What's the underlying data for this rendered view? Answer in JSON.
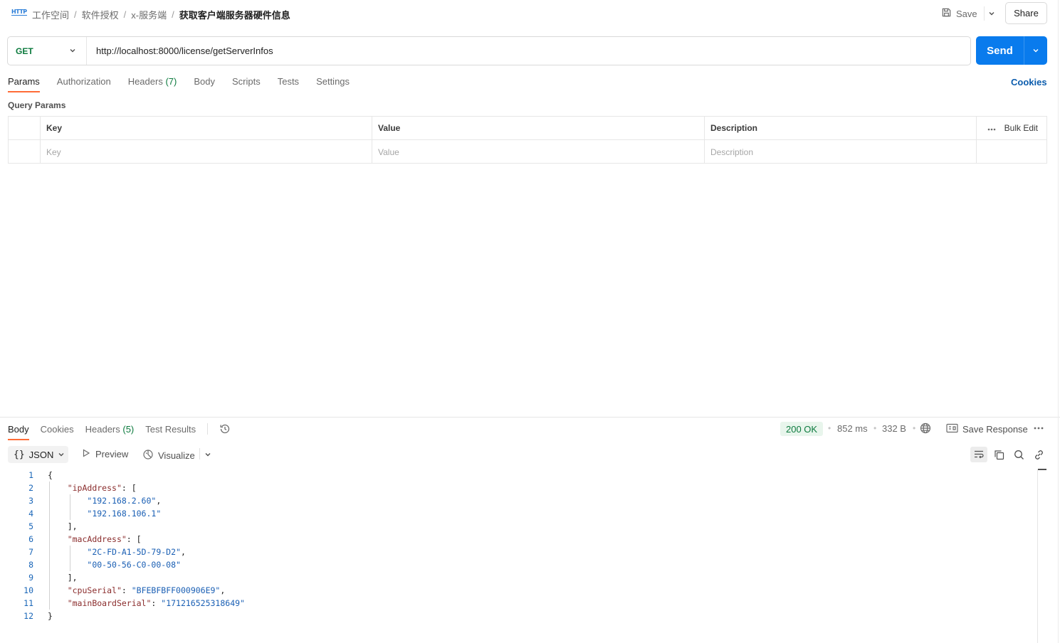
{
  "header": {
    "protocol_icon": "HTTP",
    "breadcrumbs": [
      "工作空间",
      "软件授权",
      "x-服务端"
    ],
    "separator": "/",
    "current": "获取客户端服务器硬件信息",
    "save_label": "Save",
    "share_label": "Share"
  },
  "request": {
    "method": "GET",
    "url": "http://localhost:8000/license/getServerInfos",
    "send_label": "Send",
    "cookies_label": "Cookies",
    "tabs": [
      {
        "label": "Params",
        "active": true
      },
      {
        "label": "Authorization"
      },
      {
        "label": "Headers",
        "count": "(7)"
      },
      {
        "label": "Body"
      },
      {
        "label": "Scripts"
      },
      {
        "label": "Tests"
      },
      {
        "label": "Settings"
      }
    ],
    "query_params_title": "Query Params",
    "table": {
      "headers": {
        "key": "Key",
        "value": "Value",
        "description": "Description",
        "bulk_edit": "Bulk Edit"
      },
      "placeholders": {
        "key": "Key",
        "value": "Value",
        "description": "Description"
      }
    }
  },
  "response": {
    "tabs": [
      {
        "label": "Body",
        "active": true
      },
      {
        "label": "Cookies"
      },
      {
        "label": "Headers",
        "count": "(5)"
      },
      {
        "label": "Test Results"
      }
    ],
    "status": "200 OK",
    "time": "852 ms",
    "size": "332 B",
    "save_response_label": "Save Response",
    "format": "JSON",
    "preview_label": "Preview",
    "visualize_label": "Visualize",
    "code_lines": [
      {
        "n": "1",
        "parts": [
          {
            "t": "p",
            "v": "{"
          }
        ]
      },
      {
        "n": "2",
        "parts": [
          {
            "t": "p",
            "v": "    "
          },
          {
            "t": "k",
            "v": "\"ipAddress\""
          },
          {
            "t": "p",
            "v": ": ["
          }
        ]
      },
      {
        "n": "3",
        "parts": [
          {
            "t": "p",
            "v": "        "
          },
          {
            "t": "s",
            "v": "\"192.168.2.60\""
          },
          {
            "t": "p",
            "v": ","
          }
        ]
      },
      {
        "n": "4",
        "parts": [
          {
            "t": "p",
            "v": "        "
          },
          {
            "t": "s",
            "v": "\"192.168.106.1\""
          }
        ]
      },
      {
        "n": "5",
        "parts": [
          {
            "t": "p",
            "v": "    ],"
          }
        ]
      },
      {
        "n": "6",
        "parts": [
          {
            "t": "p",
            "v": "    "
          },
          {
            "t": "k",
            "v": "\"macAddress\""
          },
          {
            "t": "p",
            "v": ": ["
          }
        ]
      },
      {
        "n": "7",
        "parts": [
          {
            "t": "p",
            "v": "        "
          },
          {
            "t": "s",
            "v": "\"2C-FD-A1-5D-79-D2\""
          },
          {
            "t": "p",
            "v": ","
          }
        ]
      },
      {
        "n": "8",
        "parts": [
          {
            "t": "p",
            "v": "        "
          },
          {
            "t": "s",
            "v": "\"00-50-56-C0-00-08\""
          }
        ]
      },
      {
        "n": "9",
        "parts": [
          {
            "t": "p",
            "v": "    ],"
          }
        ]
      },
      {
        "n": "10",
        "parts": [
          {
            "t": "p",
            "v": "    "
          },
          {
            "t": "k",
            "v": "\"cpuSerial\""
          },
          {
            "t": "p",
            "v": ": "
          },
          {
            "t": "s",
            "v": "\"BFEBFBFF000906E9\""
          },
          {
            "t": "p",
            "v": ","
          }
        ]
      },
      {
        "n": "11",
        "parts": [
          {
            "t": "p",
            "v": "    "
          },
          {
            "t": "k",
            "v": "\"mainBoardSerial\""
          },
          {
            "t": "p",
            "v": ": "
          },
          {
            "t": "s",
            "v": "\"171216525318649\""
          }
        ]
      },
      {
        "n": "12",
        "parts": [
          {
            "t": "p",
            "v": "}"
          }
        ]
      }
    ]
  },
  "colors": {
    "accent": "#ff6c37",
    "send": "#097bed",
    "method": "#0c7a3e",
    "status_ok": "#0c7a3e",
    "json_key": "#8a2c2c",
    "json_string": "#1a5fb4"
  },
  "icons": [
    "http-icon",
    "save-icon",
    "chevron-down-icon",
    "history-icon",
    "globe-icon",
    "save-response-icon",
    "more-icon",
    "braces-icon",
    "play-icon",
    "visualize-icon",
    "wrap-icon",
    "copy-icon",
    "search-icon",
    "link-icon"
  ]
}
